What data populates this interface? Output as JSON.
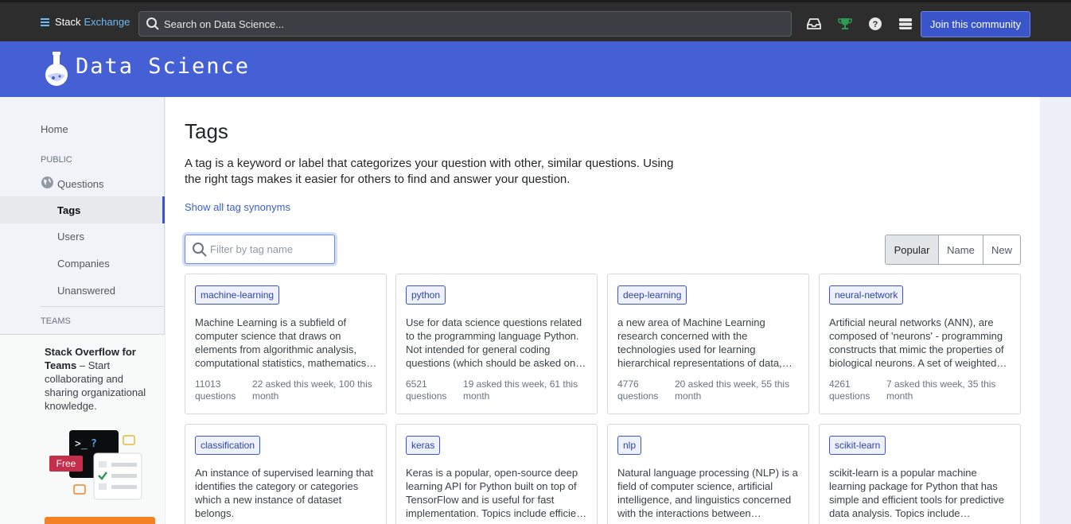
{
  "topbar": {
    "logo_stack": "Stack",
    "logo_exchange": "Exchange",
    "search_placeholder": "Search on Data Science...",
    "icons": [
      "inbox-icon",
      "achievements-icon",
      "help-icon",
      "site-switcher-icon"
    ],
    "join_label": "Join this community"
  },
  "site": {
    "name": "Data Science",
    "header_color": "#4560d4"
  },
  "sidebar": {
    "home": "Home",
    "public_label": "PUBLIC",
    "questions": "Questions",
    "tags": "Tags",
    "users": "Users",
    "companies": "Companies",
    "unanswered": "Unanswered",
    "teams_label": "TEAMS",
    "teams_title": "Stack Overflow for Teams",
    "teams_body": " – Start collaborating and sharing organizational knowledge.",
    "free_badge": "Free"
  },
  "main": {
    "title": "Tags",
    "intro": "A tag is a keyword or label that categorizes your question with other, similar questions. Using the right tags makes it easier for others to find and answer your question.",
    "synonyms_link": "Show all tag synonyms",
    "filter_placeholder": "Filter by tag name",
    "sort_options": [
      "Popular",
      "Name",
      "New"
    ],
    "sort_active": "Popular"
  },
  "tags": [
    {
      "name": "machine-learning",
      "description": "Machine Learning is a subfield of computer science that draws on elements from algorithmic analysis, computational statistics, mathematics, optimization, etc.",
      "count": "11013 questions",
      "activity": "22 asked this week, 100 this month"
    },
    {
      "name": "python",
      "description": "Use for data science questions related to the programming language Python. Not intended for general coding questions (which should be asked on Stack Overflow).",
      "count": "6521 questions",
      "activity": "19 asked this week, 61 this month"
    },
    {
      "name": "deep-learning",
      "description": "a new area of Machine Learning research concerned with the technologies used for learning hierarchical representations of data, mainly done with deep neural networks.",
      "count": "4776 questions",
      "activity": "20 asked this week, 55 this month"
    },
    {
      "name": "neural-network",
      "description": "Artificial neural networks (ANN), are composed of 'neurons' - programming constructs that mimic the properties of biological neurons. A set of weighted connections between the neurons.",
      "count": "4261 questions",
      "activity": "7 asked this week, 35 this month"
    },
    {
      "name": "classification",
      "description": "An instance of supervised learning that identifies the category or categories which a new instance of dataset belongs.",
      "count": "",
      "activity": ""
    },
    {
      "name": "keras",
      "description": "Keras is a popular, open-source deep learning API for Python built on top of TensorFlow and is useful for fast implementation. Topics include efficient model building.",
      "count": "",
      "activity": ""
    },
    {
      "name": "nlp",
      "description": "Natural language processing (NLP) is a field of computer science, artificial intelligence, and linguistics concerned with the interactions between computers and human languages.",
      "count": "",
      "activity": ""
    },
    {
      "name": "scikit-learn",
      "description": "scikit-learn is a popular machine learning package for Python that has simple and efficient tools for predictive data analysis. Topics include classification and regression.",
      "count": "",
      "activity": ""
    }
  ]
}
